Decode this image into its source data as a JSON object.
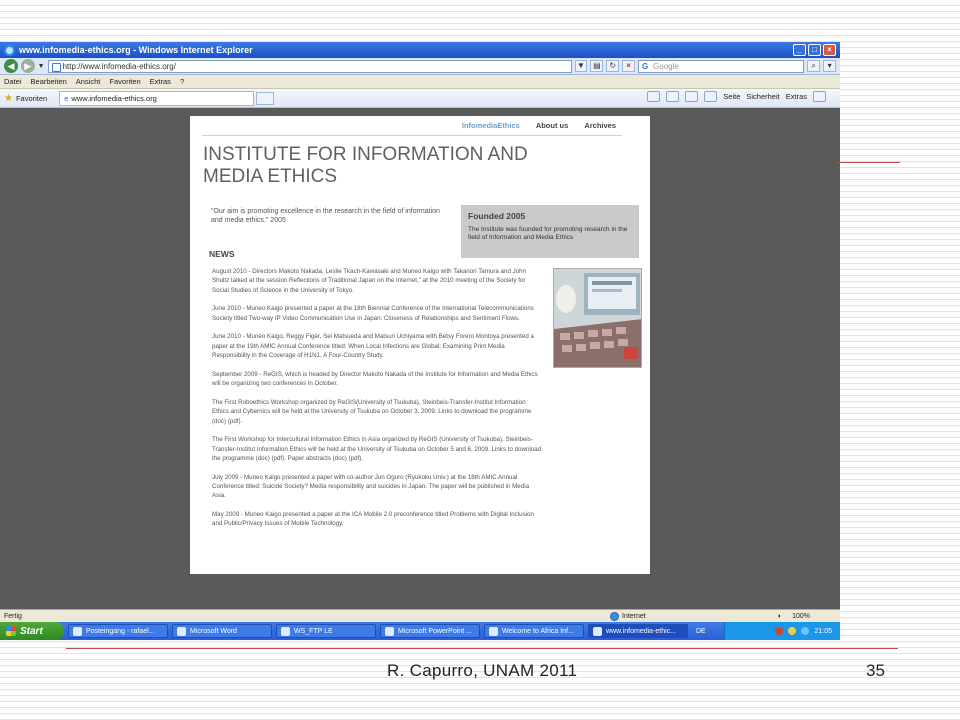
{
  "window": {
    "title": "www.infomedia-ethics.org - Windows Internet Explorer",
    "buttons": {
      "minimize": "_",
      "maximize": "□",
      "close": "×"
    }
  },
  "addressbar": {
    "url": "http://www.infomedia-ethics.org/",
    "search_placeholder": "Google"
  },
  "menubar": {
    "items": [
      "Datei",
      "Bearbeiten",
      "Ansicht",
      "Favoriten",
      "Extras",
      "?"
    ]
  },
  "favbar": {
    "favoriten": "Favoriten",
    "tab_label": "www.infomedia-ethics.org",
    "tools": [
      "Seite",
      "Sicherheit",
      "Extras"
    ]
  },
  "site": {
    "nav": [
      "InfomediaEthics",
      "About us",
      "Archives"
    ],
    "title": "INSTITUTE FOR INFORMATION AND MEDIA ETHICS",
    "mission": "\"Our aim is promoting excellence in the research in the field of information and media ethics.\" 2005",
    "founded_title": "Founded 2005",
    "founded_text": "The Institute was founded for promoting research in the field of Information and Media Ethics",
    "news_heading": "NEWS",
    "news": [
      "August 2010 - Directors Makoto Nakada, Leslie Tkach-Kawasaki and Muneo Kaigo with Takanori Tamura and John Shultz talked at the session Reflections of Traditional Japan on the Internet,\" at the 2010 meeting of the Society for Social Studies of Science in the University of Tokyo.",
      "June 2010 - Muneo Kaigo presented a paper at the 18th Biennial Conference of the International Telecommunications Society titled Two-way IP Video Communication Use in Japan: Closeness of Relationships and Sentiment Flows.",
      "June 2010 - Muneo Kaigo, Reggy Figer, Sei Matsueda and Matsuri Uchiyama with Betsy Forero Montoya presented a paper at the 19th AMIC Annual Conference titled: When Local Infections are Global: Examining Print Media Responsibility in the Coverage of H1N1, A Four-Country Study.",
      "September 2009 - ReGIS, which is headed by Director Makoto Nakada of the Institute for Information and Media Ethics will be organizing two conferences in October.",
      "The First Roboethics Workshop organized by ReGIS(University of Tsukuba), Steinbeis-Transfer-Institut Information Ethics and Cybernics will be held at the University of Tsukuba on October 3, 2009.  Links to download the programme (doc) (pdf).",
      "The First Workshop for Intercultural Information Ethics in Asia organized by ReGIS (University of Tsukuba), Steinbeis-Transfer-Institut Information Ethics will be held at the University of Tsukuba on October 5 and 6, 2009.  Links to download the programme (doc) (pdf).  Paper abstracts (doc) (pdf).",
      "July 2009 - Muneo Kaigo presented a paper with co-author Jun Oguro (Ryukoku Univ.) at the 18th AMIC Annual Conference titled: Suicide Society? Media responsibility and suicides in Japan.  The paper will be published in Media Asia.",
      "May 2009 - Muneo Kaigo presented a paper at the ICA Mobile 2.0 preconference titled Problems with Digital Inclusion and Public/Privacy Issues of Mobile Technology."
    ]
  },
  "statusbar": {
    "left": "Fertig",
    "zone": "Internet",
    "zoom": "100%"
  },
  "taskbar": {
    "start": "Start",
    "tasks": [
      "Posteingang - rafael...",
      "Microsoft Word",
      "WS_FTP LE",
      "Microsoft PowerPoint ...",
      "Welcome to Africa Inf...",
      "www.infomedia-ethic..."
    ],
    "lang": "DE",
    "clock": "21:05"
  },
  "slide": {
    "footer": "R. Capurro, UNAM 2011",
    "number": "35"
  }
}
